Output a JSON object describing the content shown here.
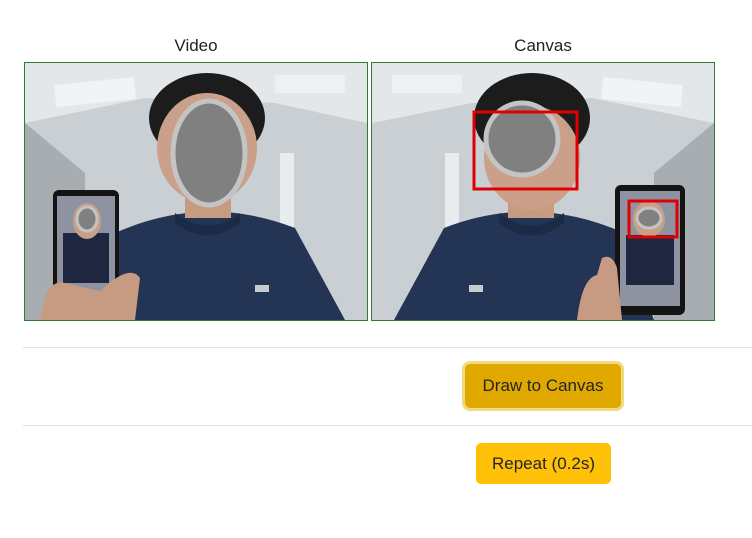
{
  "video": {
    "label": "Video"
  },
  "canvas": {
    "label": "Canvas"
  },
  "buttons": {
    "draw_label": "Draw to Canvas",
    "repeat_label": "Repeat (0.2s)"
  },
  "colors": {
    "frame_border": "#2e7d32",
    "detection_box": "#e00000",
    "draw_button": "#e1a900",
    "repeat_button": "#ffc107"
  }
}
